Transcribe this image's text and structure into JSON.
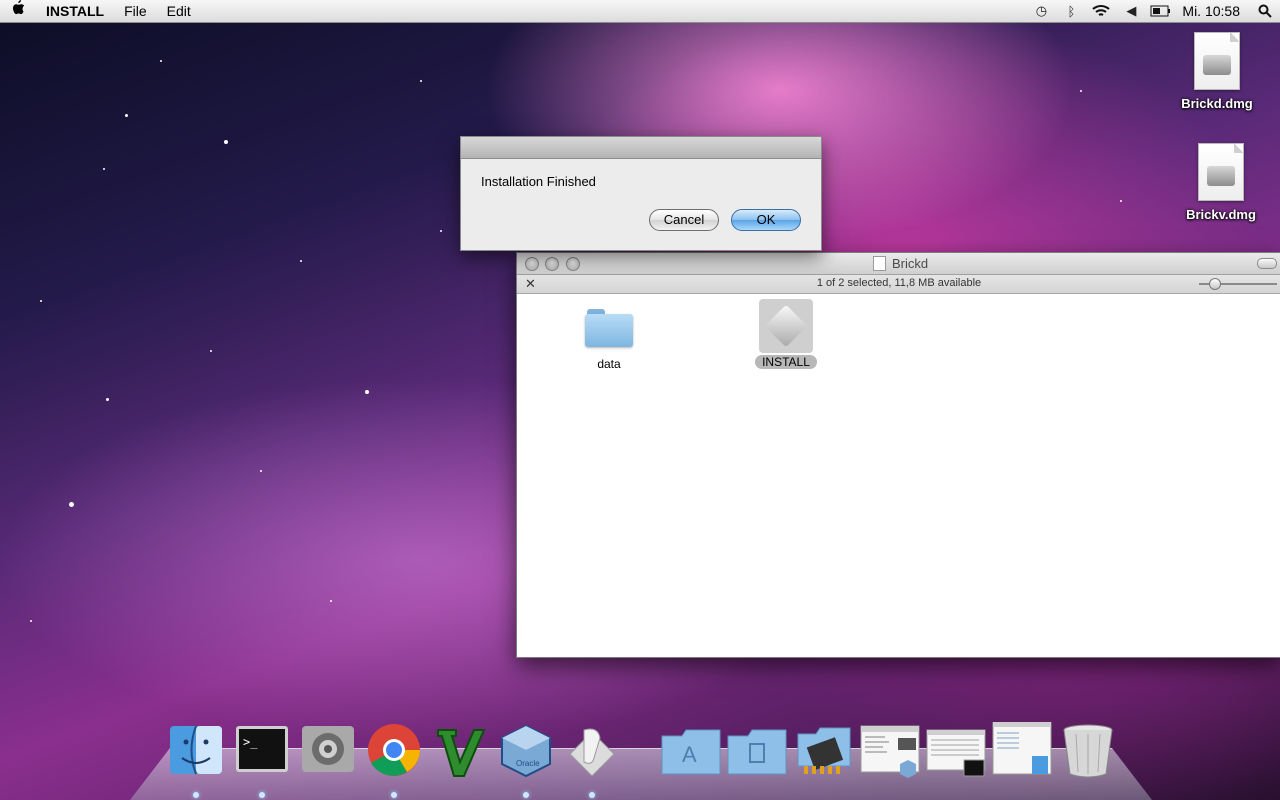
{
  "menubar": {
    "app_name": "INSTALL",
    "menus": [
      "File",
      "Edit"
    ],
    "clock": "Mi. 10:58"
  },
  "desktop_icons": [
    {
      "label": "Brickd.dmg",
      "icon": "disk-image-icon"
    },
    {
      "label": "Brickv.dmg",
      "icon": "disk-image-icon"
    }
  ],
  "alert": {
    "message": "Installation Finished",
    "cancel_label": "Cancel",
    "ok_label": "OK"
  },
  "finder": {
    "title": "Brickd",
    "status": "1 of 2 selected, 11,8 MB available",
    "items": [
      {
        "label": "data",
        "icon": "folder-icon",
        "selected": false
      },
      {
        "label": "INSTALL",
        "icon": "installer-script-icon",
        "selected": true
      }
    ]
  },
  "dock": {
    "items": [
      "finder-icon",
      "terminal-icon",
      "system-preferences-icon",
      "chrome-icon",
      "vim-icon",
      "virtualbox-icon",
      "script-editor-icon",
      "applications-folder-icon",
      "documents-folder-icon",
      "brick-folder-icon",
      "window-thumbnail-icon",
      "window-thumbnail-icon",
      "window-thumbnail-icon",
      "trash-icon"
    ]
  }
}
